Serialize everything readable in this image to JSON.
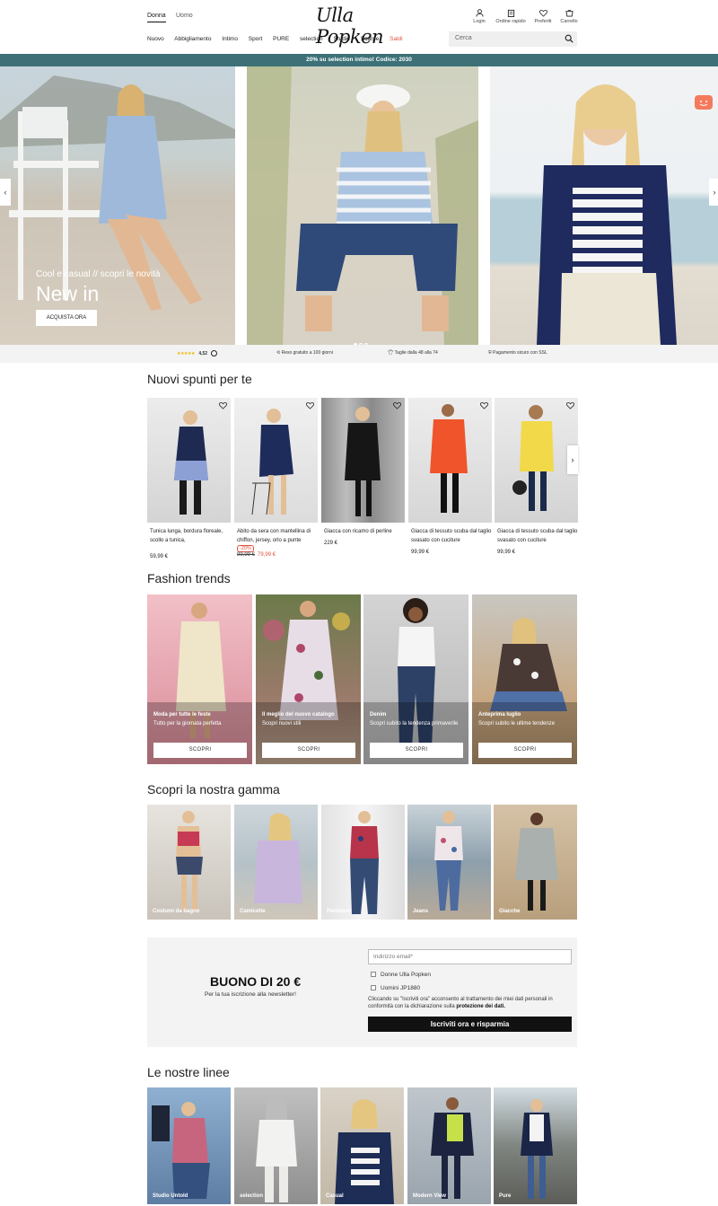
{
  "header": {
    "gender_tabs": [
      "Donna",
      "Uomo"
    ],
    "logo": "Ulla Popken",
    "icons": [
      {
        "label": "Login",
        "icon": "user-icon"
      },
      {
        "label": "Ordine rapido",
        "icon": "quick-order-icon"
      },
      {
        "label": "Preferiti",
        "icon": "heart-icon"
      },
      {
        "label": "Carrello",
        "icon": "cart-icon"
      }
    ],
    "nav": [
      "Nuovo",
      "Abbigliamento",
      "Intimo",
      "Sport",
      "PURE",
      "selection",
      "Studio",
      "Scarpe",
      "Saldi"
    ],
    "search_placeholder": "Cerca"
  },
  "promo_bar": "20% su selection intimo! Codice: 2030",
  "hero": {
    "kicker": "Cool e casual // scopri le novità",
    "title": "New in",
    "cta": "ACQUISTA ORA",
    "active_slide": 1,
    "slide_count": 3
  },
  "usp": {
    "rating": "4,52",
    "stars": "★★★★★",
    "items": [
      "Reso gratuito a 100 giorni",
      "Taglie dalla 48 alla 74",
      "Pagamento sicuro con SSL"
    ]
  },
  "suggestions": {
    "title": "Nuovi spunti per te",
    "products": [
      {
        "name": "Tunica lunga, bordura floreale, scollo a tunica,",
        "price": "59,99 €"
      },
      {
        "name": "Abito da sera con mantellina di chiffon, jersey, orlo a punte",
        "discount": "-20%",
        "old_price": "99,99 €",
        "new_price": "79,99 €"
      },
      {
        "name": "Giacca con ricamo di perline",
        "price": "229 €"
      },
      {
        "name": "Giacca di tessuto scuba dal taglio svasato con cuciture",
        "price": "99,99 €"
      },
      {
        "name": "Giacca di tessuto scuba dal taglio svasato con cuciture",
        "price": "99,99 €"
      }
    ]
  },
  "trends": {
    "title": "Fashion trends",
    "cards": [
      {
        "title": "Moda per tutte le feste",
        "subtitle": "Tutto per la giornata perfetta",
        "cta": "SCOPRI"
      },
      {
        "title": "Il meglio del nuovo catalogo",
        "subtitle": "Scopri nuovi stili",
        "cta": "SCOPRI"
      },
      {
        "title": "Denim",
        "subtitle": "Scopri subito la tendenza primaverile",
        "cta": "SCOPRI"
      },
      {
        "title": "Anteprima luglio",
        "subtitle": "Scopri subito le ultime tendenze",
        "cta": "SCOPRI"
      }
    ]
  },
  "range": {
    "title": "Scopri la nostra gamma",
    "items": [
      "Costumi da bagno",
      "Camicette",
      "Pantaloni",
      "Jeans",
      "Giacche"
    ]
  },
  "newsletter": {
    "title": "BUONO DI 20 €",
    "subtitle": "Per la tua iscrizione alla newsletter!",
    "email_placeholder": "Indirizzo email*",
    "options": [
      "Donne Ulla Popken",
      "Uomini JP1880"
    ],
    "legal": "Cliccando su \"Iscriviti ora\" acconsento al trattamento dei miei dati personali in conformità con la dichiarazione sulla",
    "legal_link": "protezione dei dati.",
    "cta": "Iscriviti ora e risparmia"
  },
  "lines": {
    "title": "Le nostre linee",
    "items": [
      "Studio Untold",
      "selection",
      "Casual",
      "Modern View",
      "Pure"
    ]
  },
  "colors": {
    "promo_bg": "#3d7177",
    "sale": "#e0533d",
    "star": "#f0b400",
    "chat": "#f47a5e"
  }
}
